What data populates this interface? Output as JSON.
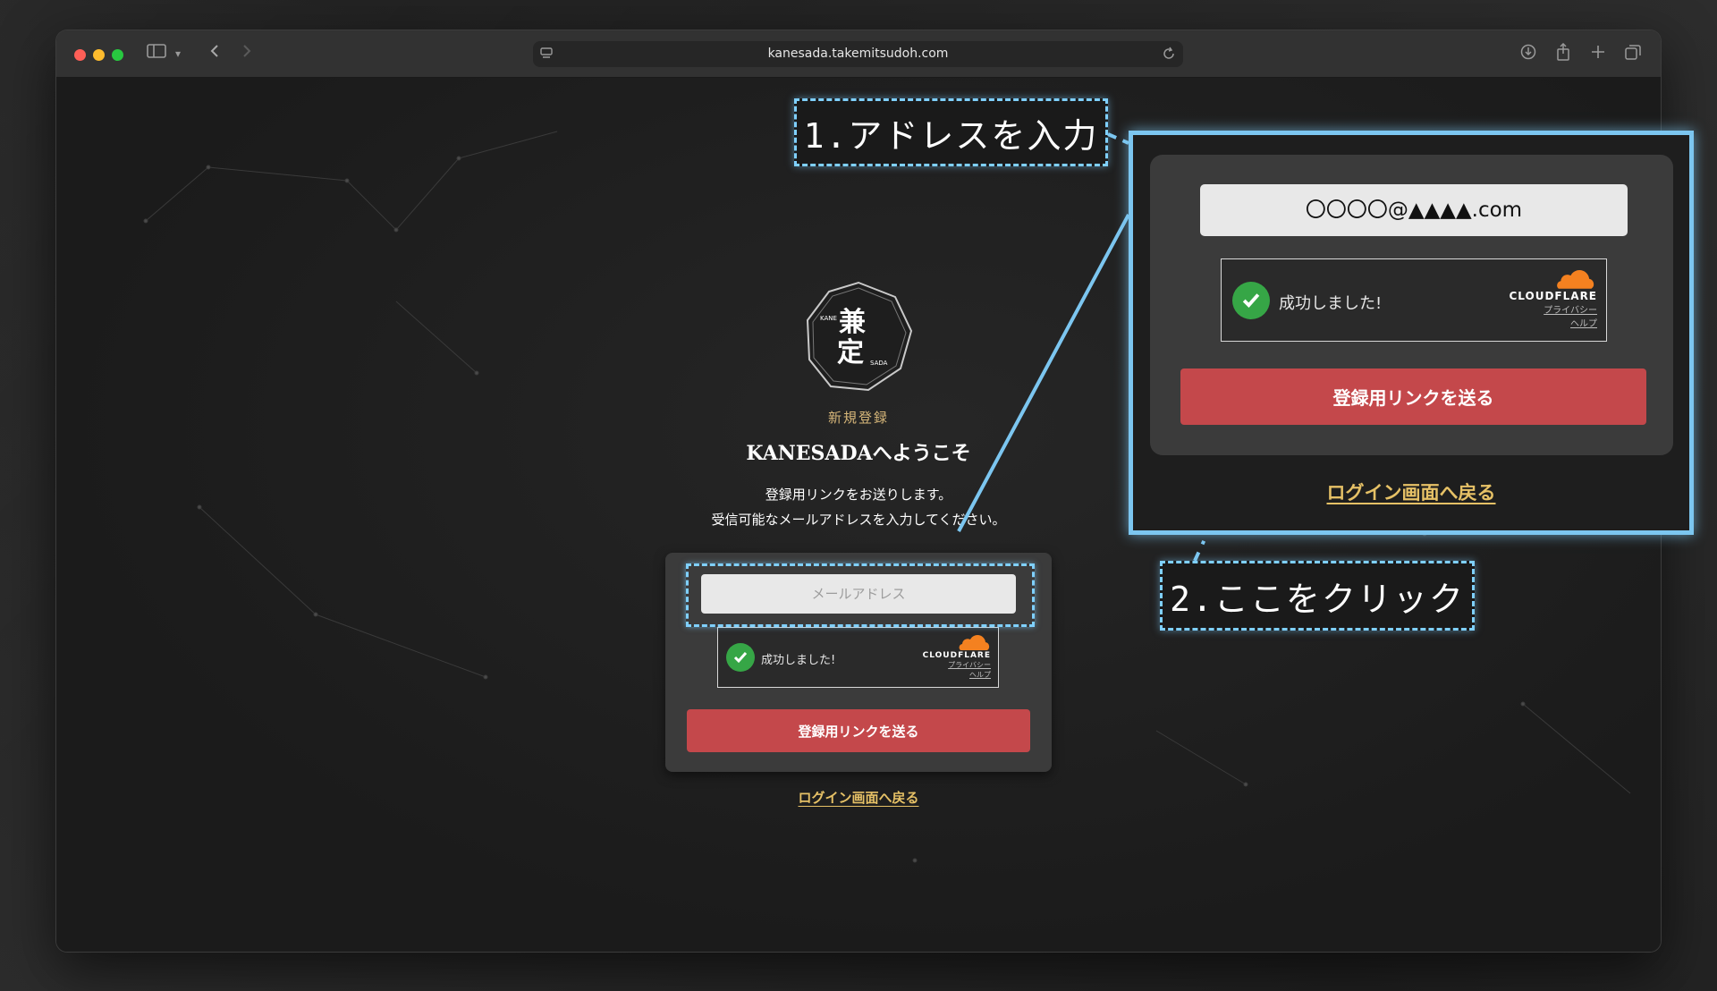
{
  "browser": {
    "url": "kanesada.takemitsudoh.com"
  },
  "logo": {
    "main_top": "兼",
    "main_bottom": "定",
    "small_left": "KANE",
    "small_right": "SADA"
  },
  "page": {
    "subtitle": "新規登録",
    "welcome": "KANESADAへようこそ",
    "desc_line1": "登録用リンクをお送りします。",
    "desc_line2": "受信可能なメールアドレスを入力してください。"
  },
  "form": {
    "email_placeholder": "メールアドレス",
    "captcha_status": "成功しました!",
    "captcha_brand": "CLOUDFLARE",
    "captcha_privacy": "プライバシー",
    "captcha_help": "ヘルプ",
    "submit_label": "登録用リンクを送る",
    "back_link": "ログイン画面へ戻る"
  },
  "zoom": {
    "email_value": "〇〇〇〇@▲▲▲▲.com"
  },
  "annotations": {
    "step1": "1.アドレスを入力",
    "step2": "2.ここをクリック"
  },
  "colors": {
    "accent_gold": "#e6c166",
    "button_red": "#c4484b",
    "highlight_blue": "#7fd0ff",
    "check_green": "#36a646",
    "cloudflare_orange": "#f48120"
  }
}
